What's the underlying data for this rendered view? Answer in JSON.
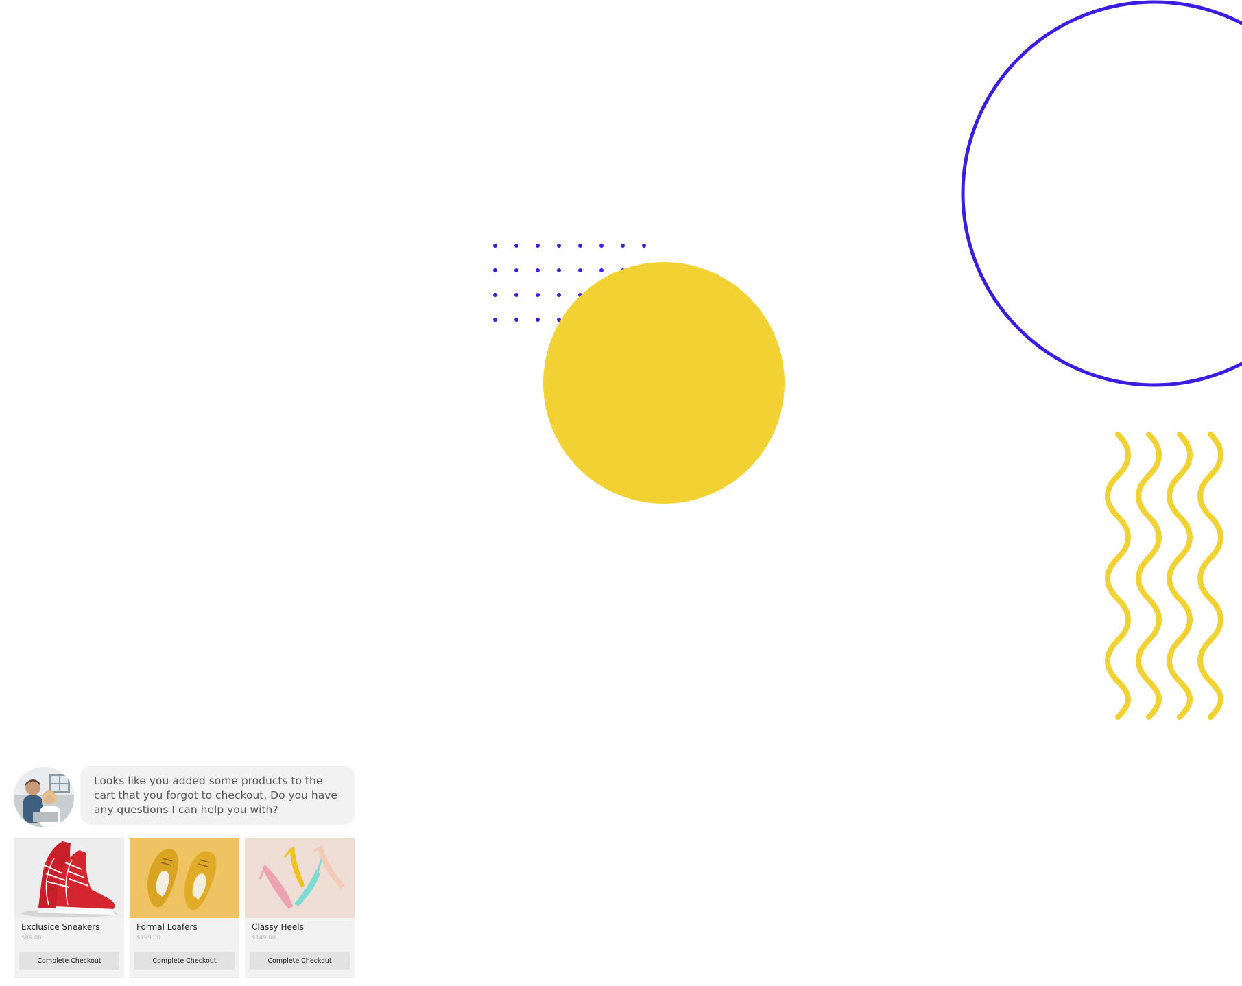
{
  "colors": {
    "accent_blue": "#3a1de0",
    "accent_yellow": "#f2d132",
    "bubble_bg": "#f2f2f2",
    "card_bg": "#f2f2f2",
    "button_bg": "#e2e2e2"
  },
  "decorations": {
    "icons": [
      "dot-grid-pattern",
      "yellow-circle",
      "blue-ring-outline",
      "yellow-wavy-lines"
    ]
  },
  "chat": {
    "avatar_icon": "agent-avatar-photo",
    "message": "Looks like you added some products to the cart that you forgot to checkout. Do you have any questions I can help you with?"
  },
  "products": [
    {
      "name": "Exclusice Sneakers",
      "price": "$99.00",
      "button": "Complete Checkout",
      "image_icon": "red-sneakers-photo"
    },
    {
      "name": "Formal Loafers",
      "price": "$199.00",
      "button": "Complete Checkout",
      "image_icon": "yellow-loafers-photo"
    },
    {
      "name": "Classy Heels",
      "price": "$149.00",
      "button": "Complete Checkout",
      "image_icon": "pastel-heels-photo"
    }
  ]
}
